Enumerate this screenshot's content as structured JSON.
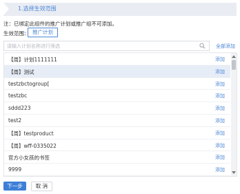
{
  "step": {
    "title": "1.选择生效范围"
  },
  "note": "注：已绑定此组件的推广计划或推广组不可添加。",
  "scope": {
    "label": "生效范围：",
    "tag": "推广计划"
  },
  "search": {
    "placeholder": "请输入计划名称进行筛选",
    "add_all_label": "全部添加"
  },
  "list": {
    "items": [
      {
        "name": "【周】计划1111111",
        "action": "添加",
        "highlight": false
      },
      {
        "name": "【周】测试",
        "action": "添加",
        "highlight": true
      },
      {
        "name": "testzbctogroup[",
        "action": "添加",
        "highlight": false
      },
      {
        "name": "testzbc",
        "action": "添加",
        "highlight": false
      },
      {
        "name": "sddd223",
        "action": "添加",
        "highlight": false
      },
      {
        "name": "test2",
        "action": "添加",
        "highlight": false
      },
      {
        "name": "【周】testproduct",
        "action": "添加",
        "highlight": false
      },
      {
        "name": "【周】wff-0335022",
        "action": "添加",
        "highlight": false
      },
      {
        "name": "官方小女孩的书签",
        "action": "添加",
        "highlight": false
      },
      {
        "name": "9999",
        "action": "添加",
        "highlight": false
      }
    ]
  },
  "buttons": {
    "next": "下一步",
    "cancel": "取 消"
  },
  "colors": {
    "accent": "#4a86d6",
    "primary_button": "#3d7fd6",
    "highlight_row": "#e7edf7"
  }
}
